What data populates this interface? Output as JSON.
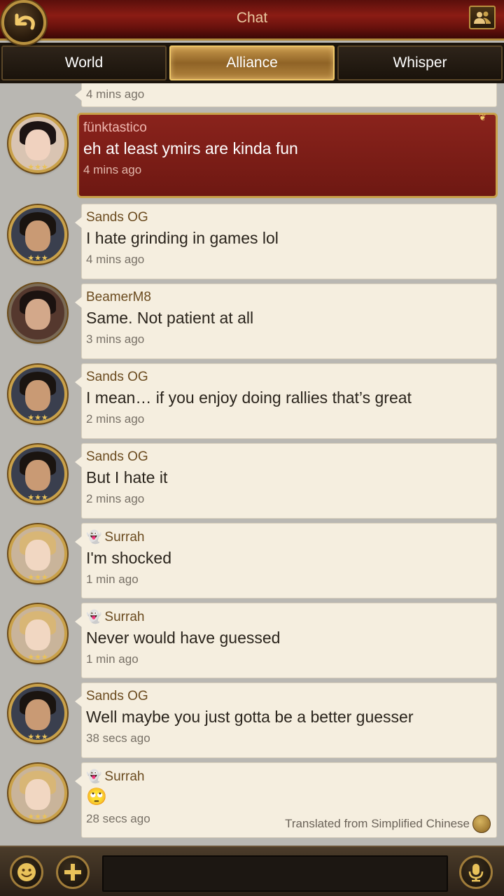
{
  "header": {
    "title": "Chat",
    "back_icon": "back-arrow-icon",
    "contacts_icon": "contacts-icon"
  },
  "tabs": [
    {
      "label": "World",
      "active": false
    },
    {
      "label": "Alliance",
      "active": true
    },
    {
      "label": "Whisper",
      "active": false
    }
  ],
  "messages": [
    {
      "sender": "",
      "text": "",
      "time": "4 mins ago"
    },
    {
      "sender": "fünktastico",
      "text": "eh at least ymirs are kinda fun",
      "time": "4 mins ago",
      "own": true
    },
    {
      "sender": "Sands OG",
      "text": "I hate grinding in games lol",
      "time": "4 mins ago"
    },
    {
      "sender": "BeamerM8",
      "text": "Same. Not patient at all",
      "time": "3 mins ago"
    },
    {
      "sender": "Sands OG",
      "text": "I mean… if you enjoy doing rallies that’s great",
      "time": "2 mins ago"
    },
    {
      "sender": "Sands OG",
      "text": "But I hate it",
      "time": "2 mins ago"
    },
    {
      "sender": "Surrah",
      "text": "I'm shocked",
      "time": "1 min ago",
      "ghost": true
    },
    {
      "sender": "Surrah",
      "text": "Never would have guessed",
      "time": "1 min ago",
      "ghost": true
    },
    {
      "sender": "Sands OG",
      "text": "Well maybe you just gotta be a better guesser",
      "time": "38 secs ago"
    },
    {
      "sender": "Surrah",
      "text": "🙄",
      "time": "28 secs ago",
      "ghost": true,
      "translated": "Translated from Simplified Chinese"
    }
  ],
  "ghost_glyph": "👻",
  "bottom": {
    "emoji_icon": "emoji-icon",
    "add_icon": "plus-icon",
    "input_value": "",
    "mic_icon": "microphone-icon"
  },
  "colors": {
    "header_red": "#8b1c14",
    "gold": "#c9a14a",
    "bubble": "#f5eedf",
    "own_bubble": "#7e1e17"
  }
}
